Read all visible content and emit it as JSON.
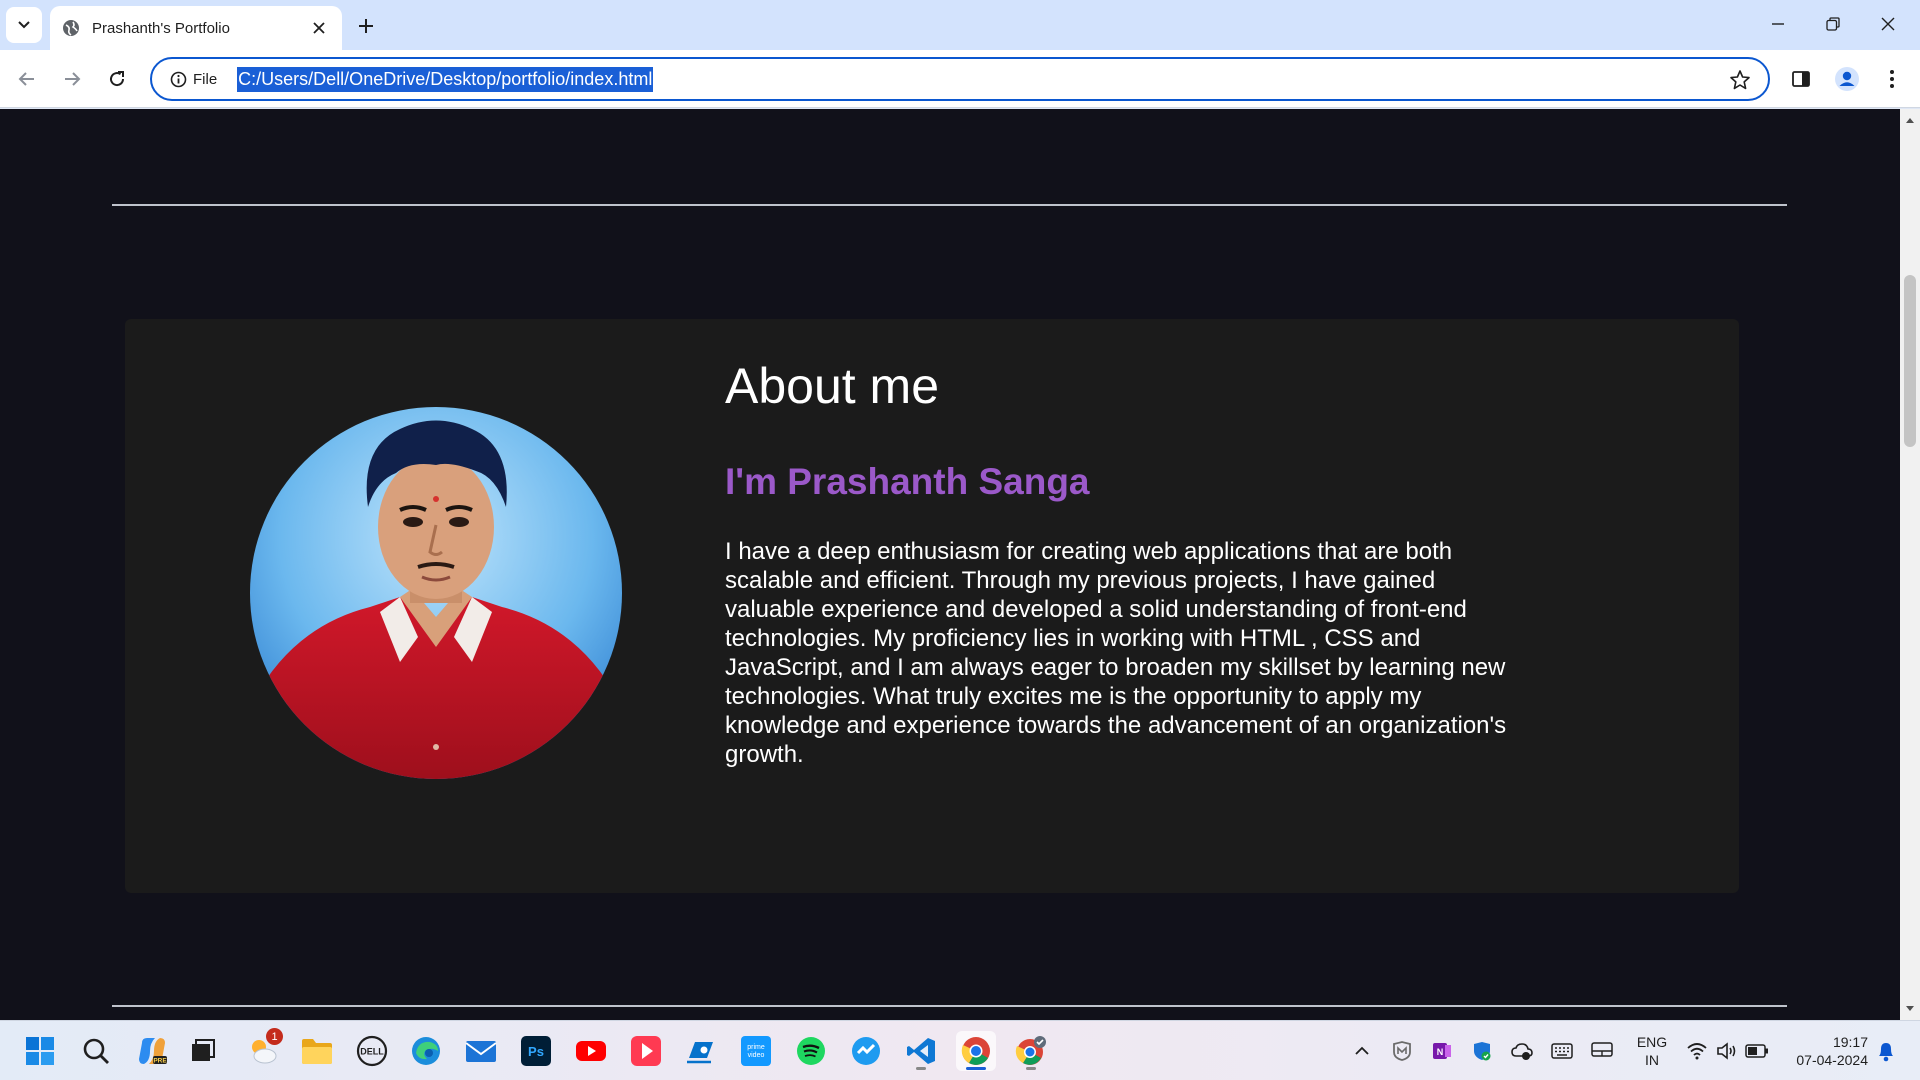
{
  "browser": {
    "tab_title": "Prashanth's Portfolio",
    "site_info_label": "File",
    "url": "C:/Users/Dell/OneDrive/Desktop/portfolio/index.html"
  },
  "page": {
    "about": {
      "heading": "About me",
      "name": "I'm Prashanth Sanga",
      "description": "I have a deep enthusiasm for creating web applications that are both scalable and efficient. Through my previous projects, I have gained valuable experience and developed a solid understanding of front-end technologies. My proficiency lies in working with HTML , CSS and JavaScript, and I am always eager to broaden my skillset by learning new technologies. What truly excites me is the opportunity to apply my knowledge and experience towards the advancement of an organization's growth."
    }
  },
  "taskbar": {
    "apps": [
      "start-icon",
      "search-icon",
      "copilot-icon",
      "task-view-icon",
      "weather-icon",
      "file-explorer-icon",
      "dell-icon",
      "edge-icon",
      "mail-icon",
      "photoshop-icon",
      "youtube-icon",
      "video-player-icon",
      "support-assist-icon",
      "prime-video-icon",
      "spotify-icon",
      "app-icon",
      "vscode-icon",
      "chrome-icon",
      "chrome-dev-icon"
    ],
    "weather_badge": "1",
    "language_line1": "ENG",
    "language_line2": "IN",
    "time": "19:17",
    "date": "07-04-2024"
  },
  "colors": {
    "page_bg": "#11111a",
    "card_bg": "#1b1b1b",
    "accent_name": "#9b59c9",
    "url_highlight": "#1a5fd6"
  }
}
